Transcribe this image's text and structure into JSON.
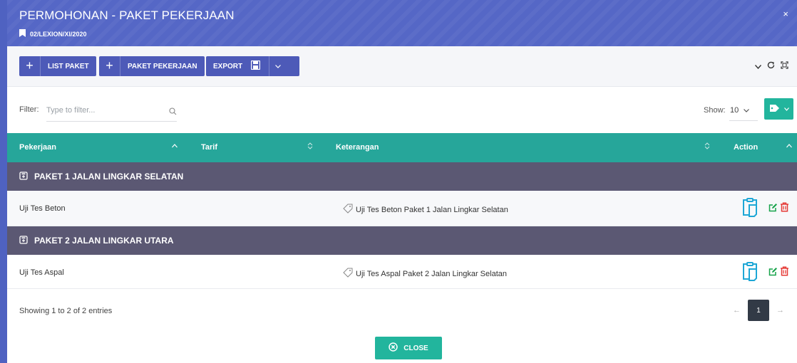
{
  "header": {
    "title": "PERMOHONAN - PAKET PEKERJAAN",
    "subtitle": "02/LEXION/XI/2020",
    "close_symbol": "×"
  },
  "toolbar": {
    "list_paket_label": "LIST PAKET",
    "paket_pekerjaan_label": "PAKET PEKERJAAN",
    "export_label": "EXPORT"
  },
  "filter": {
    "label": "Filter:",
    "placeholder": "Type to filter...",
    "show_label": "Show:",
    "show_value": "10"
  },
  "table": {
    "columns": [
      "Pekerjaan",
      "Tarif",
      "Keterangan",
      "Action"
    ],
    "groups": [
      {
        "title": "PAKET 1 JALAN LINGKAR SELATAN",
        "rows": [
          {
            "pekerjaan": "Uji Tes Beton",
            "tarif": "",
            "keterangan": "Uji Tes Beton Paket 1 Jalan Lingkar Selatan"
          }
        ]
      },
      {
        "title": "PAKET 2 JALAN LINGKAR UTARA",
        "rows": [
          {
            "pekerjaan": "Uji Tes Aspal",
            "tarif": "",
            "keterangan": "Uji Tes Aspal Paket 2 Jalan Lingkar Selatan"
          }
        ]
      }
    ]
  },
  "footer": {
    "entries_text": "Showing 1 to 2 of 2 entries",
    "prev": "←",
    "current_page": "1",
    "next": "→",
    "close_label": "CLOSE"
  },
  "colors": {
    "header": "#5567c6",
    "toolbar_button": "#4d5ab8",
    "table_header": "#26a69a",
    "group_row": "#5b5873",
    "accent_teal": "#22b59d",
    "delete_red": "#e53935"
  },
  "icons": [
    "bookmark-icon",
    "plus-icon",
    "save-icon",
    "chevron-down-icon",
    "refresh-icon",
    "expand-icon",
    "search-icon",
    "tag-icon",
    "sort-icon",
    "clipboard-icon",
    "edit-icon",
    "trash-icon",
    "close-circle-icon"
  ]
}
